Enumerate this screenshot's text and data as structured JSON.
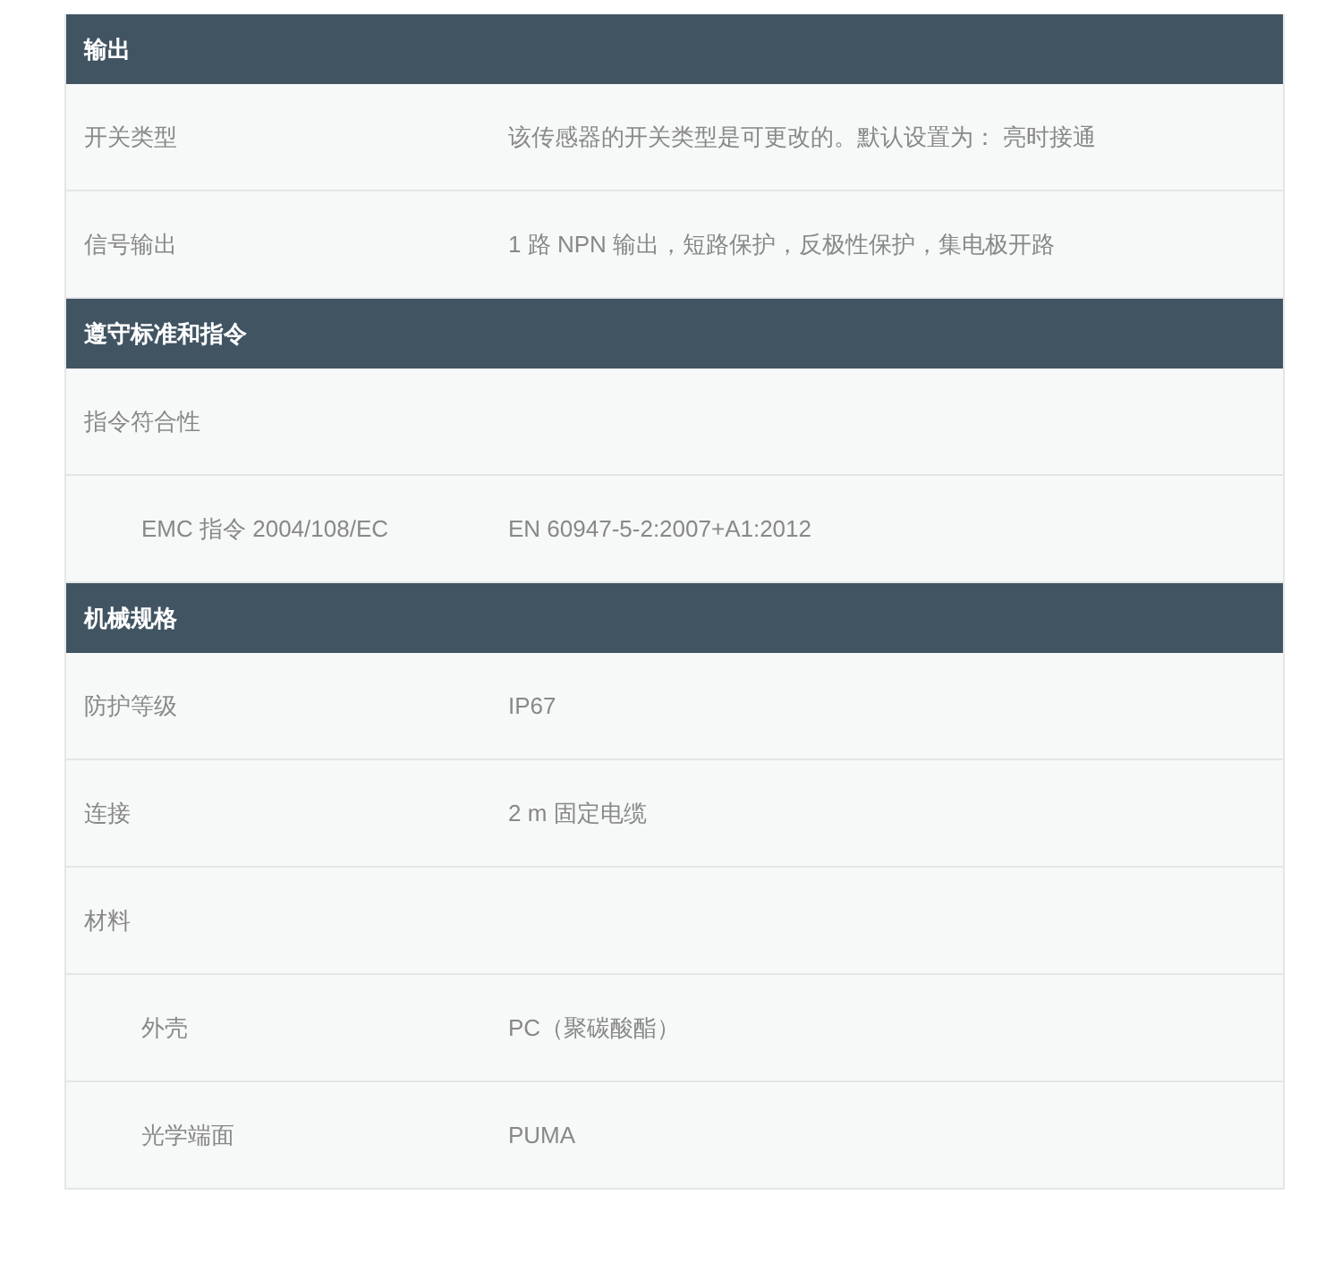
{
  "sections": [
    {
      "title": "输出",
      "rows": [
        {
          "label": "开关类型",
          "value": "该传感器的开关类型是可更改的。默认设置为： 亮时接通"
        },
        {
          "label": "信号输出",
          "value": "1 路 NPN 输出，短路保护，反极性保护，集电极开路"
        }
      ]
    },
    {
      "title": "遵守标准和指令",
      "rows": [
        {
          "label": "指令符合性",
          "children": [
            {
              "label": "EMC 指令 2004/108/EC",
              "value": "EN 60947-5-2:2007+A1:2012"
            }
          ]
        }
      ]
    },
    {
      "title": "机械规格",
      "rows": [
        {
          "label": "防护等级",
          "value": "IP67"
        },
        {
          "label": "连接",
          "value": "2 m 固定电缆"
        },
        {
          "label": "材料",
          "children": [
            {
              "label": "外壳",
              "value": "PC（聚碳酸酯）"
            },
            {
              "label": "光学端面",
              "value": "PUMA"
            }
          ]
        }
      ]
    }
  ]
}
